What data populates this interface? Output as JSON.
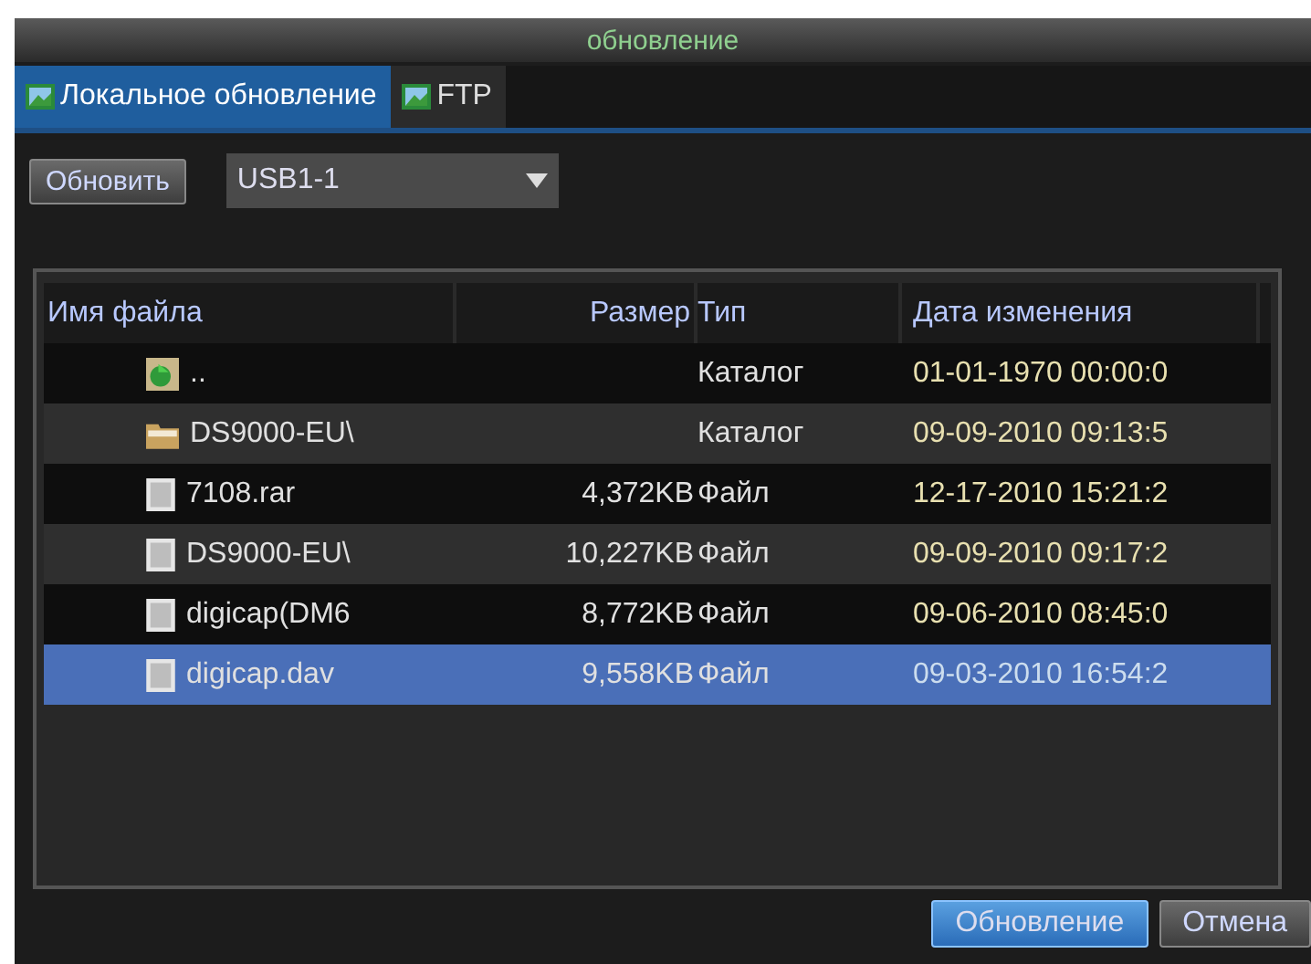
{
  "window": {
    "title": "обновление"
  },
  "tabs": [
    {
      "label": "Локальное обновление",
      "selected": true
    },
    {
      "label": "FTP",
      "selected": false
    }
  ],
  "toolbar": {
    "refresh_button": "Обновить",
    "device": {
      "value": "USB1-1"
    }
  },
  "table": {
    "columns": [
      "Имя файла",
      "Размер",
      "Тип",
      "Дата изменения"
    ],
    "rows": [
      {
        "kind": "parent",
        "name": "..",
        "size": "",
        "type": "Каталог",
        "date": "01-01-1970 00:00:0",
        "selected": false
      },
      {
        "kind": "folder",
        "name": "DS9000-EU\\",
        "size": "",
        "type": "Каталог",
        "date": "09-09-2010 09:13:5",
        "selected": false
      },
      {
        "kind": "file",
        "name": "7108.rar",
        "size": "4,372KB",
        "type": "Файл",
        "date": "12-17-2010 15:21:2",
        "selected": false
      },
      {
        "kind": "file",
        "name": "DS9000-EU\\",
        "size": "10,227KB",
        "type": "Файл",
        "date": "09-09-2010 09:17:2",
        "selected": false
      },
      {
        "kind": "file",
        "name": "digicap(DM6",
        "size": "8,772KB",
        "type": "Файл",
        "date": "09-06-2010 08:45:0",
        "selected": false
      },
      {
        "kind": "file",
        "name": "digicap.dav",
        "size": "9,558KB",
        "type": "Файл",
        "date": "09-03-2010 16:54:2",
        "selected": true
      }
    ]
  },
  "buttons": [
    {
      "label": "Обновление",
      "kind": "primary"
    },
    {
      "label": "Отмена",
      "kind": "normal"
    }
  ]
}
